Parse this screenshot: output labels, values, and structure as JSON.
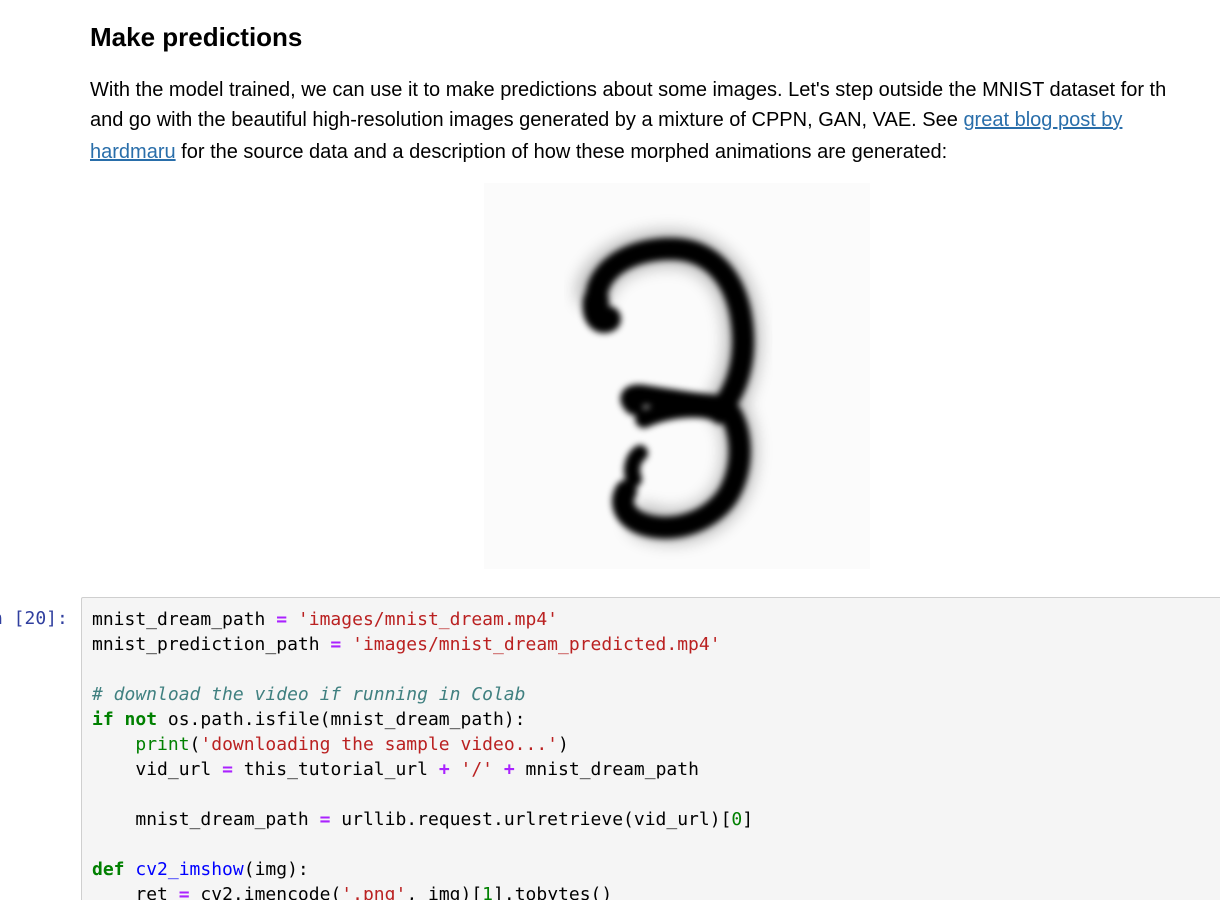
{
  "markdown": {
    "heading": "Make predictions",
    "paragraph": {
      "line1": "With the model trained, we can use it to make predictions about some images. Let's step outside the MNIST dataset for th",
      "line2_before_link": "and go with the beautiful high-resolution images generated by a mixture of CPPN, GAN, VAE. See ",
      "link_part1": "great blog post by",
      "link_part2": "hardmaru",
      "line3_after_link": " for the source data and a description of how these morphed animations are generated:"
    },
    "figure_icon": "handwritten-digit-three-image"
  },
  "code_cell": {
    "prompt": "n [20]:",
    "lines": {
      "l1": {
        "a": "mnist_dream_path ",
        "op": "=",
        "b": " ",
        "s": "'images/mnist_dream.mp4'"
      },
      "l2": {
        "a": "mnist_prediction_path ",
        "op": "=",
        "b": " ",
        "s": "'images/mnist_dream_predicted.mp4'"
      },
      "l3": {
        "c": "# download the video if running in Colab"
      },
      "l4": {
        "k1": "if",
        "sp": " ",
        "k2": "not",
        "rest": " os.path.isfile(mnist_dream_path):"
      },
      "l5": {
        "indent": "    ",
        "bi": "print",
        "p1": "(",
        "s": "'downloading the sample video...'",
        "p2": ")"
      },
      "l6": {
        "indent": "    ",
        "a": "vid_url ",
        "op1": "=",
        "b": " this_tutorial_url ",
        "op2": "+",
        "sp1": " ",
        "s": "'/'",
        "sp2": " ",
        "op3": "+",
        "c": " mnist_dream_path"
      },
      "l7": {
        "indent": "    ",
        "a": "mnist_dream_path ",
        "op": "=",
        "b": " urllib.request.urlretrieve(vid_url)[",
        "n": "0",
        "e": "]"
      },
      "l8": {
        "k": "def",
        "sp": " ",
        "fn": "cv2_imshow",
        "rest": "(img):"
      },
      "l9": {
        "indent": "    ",
        "a": "ret ",
        "op": "=",
        "b": " cv2.imencode(",
        "s": "'.png'",
        "c": ", img)[",
        "n": "1",
        "e": "].tobytes()"
      }
    }
  }
}
